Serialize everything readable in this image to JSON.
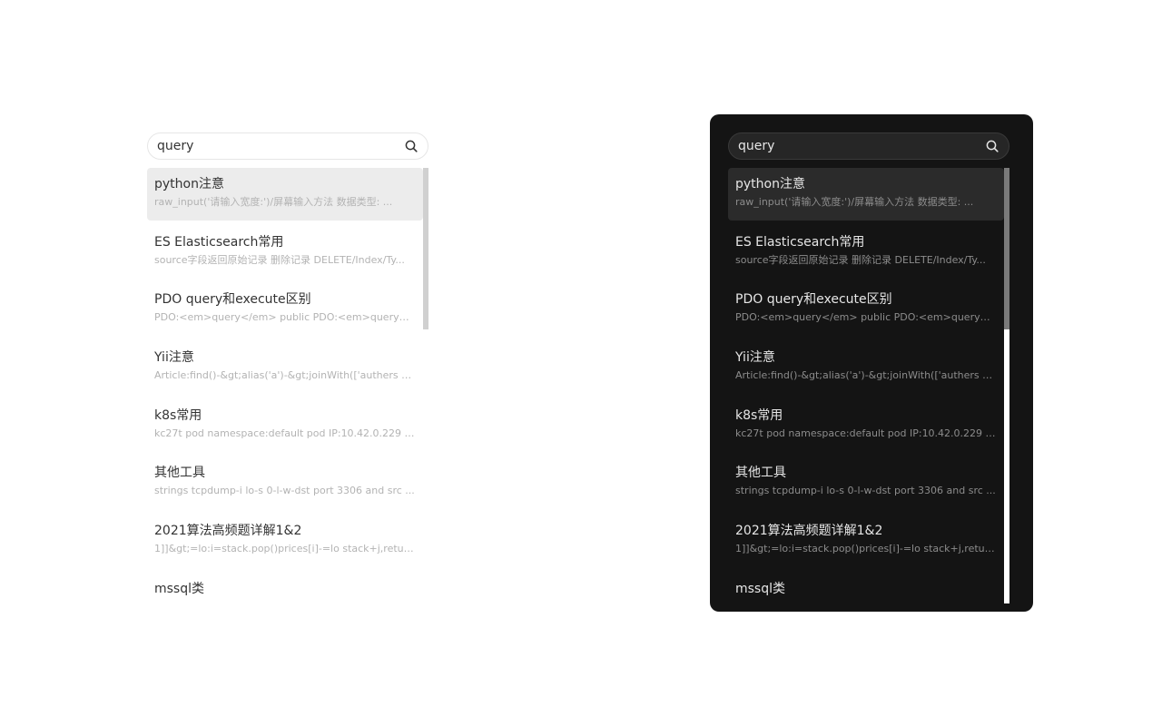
{
  "search": {
    "query": "query"
  },
  "results": [
    {
      "title": "python注意",
      "snippet": "raw_input('请输入宽度:')/屏幕输入方法 数据类型: ..."
    },
    {
      "title": "ES Elasticsearch常用",
      "snippet": "source字段返回原始记录 删除记录 DELETE/Index/Ty..."
    },
    {
      "title": "PDO query和execute区别",
      "snippet": "PDO:<em>query</em> public PDO:<em>query<..."
    },
    {
      "title": "Yii注意",
      "snippet": "Article:find()-&gt;alias('a')-&gt;joinWith(['authers b'..."
    },
    {
      "title": "k8s常用",
      "snippet": "kc27t pod namespace:default pod IP:10.42.0.229 Se..."
    },
    {
      "title": "其他工具",
      "snippet": "strings tcpdump-i lo-s 0-l-w-dst port 3306 and src ..."
    },
    {
      "title": "2021算法高频题详解1&2",
      "snippet": "1]]&gt;=lo:i=stack.pop()prices[i]-=lo stack+j,return p..."
    },
    {
      "title": "mssql类",
      "snippet": ""
    }
  ],
  "selected_index": 0,
  "colors": {
    "light_background": "#ffffff",
    "light_selected": "#ececec",
    "dark_background": "#141414",
    "dark_selected": "#2b2b2b"
  }
}
